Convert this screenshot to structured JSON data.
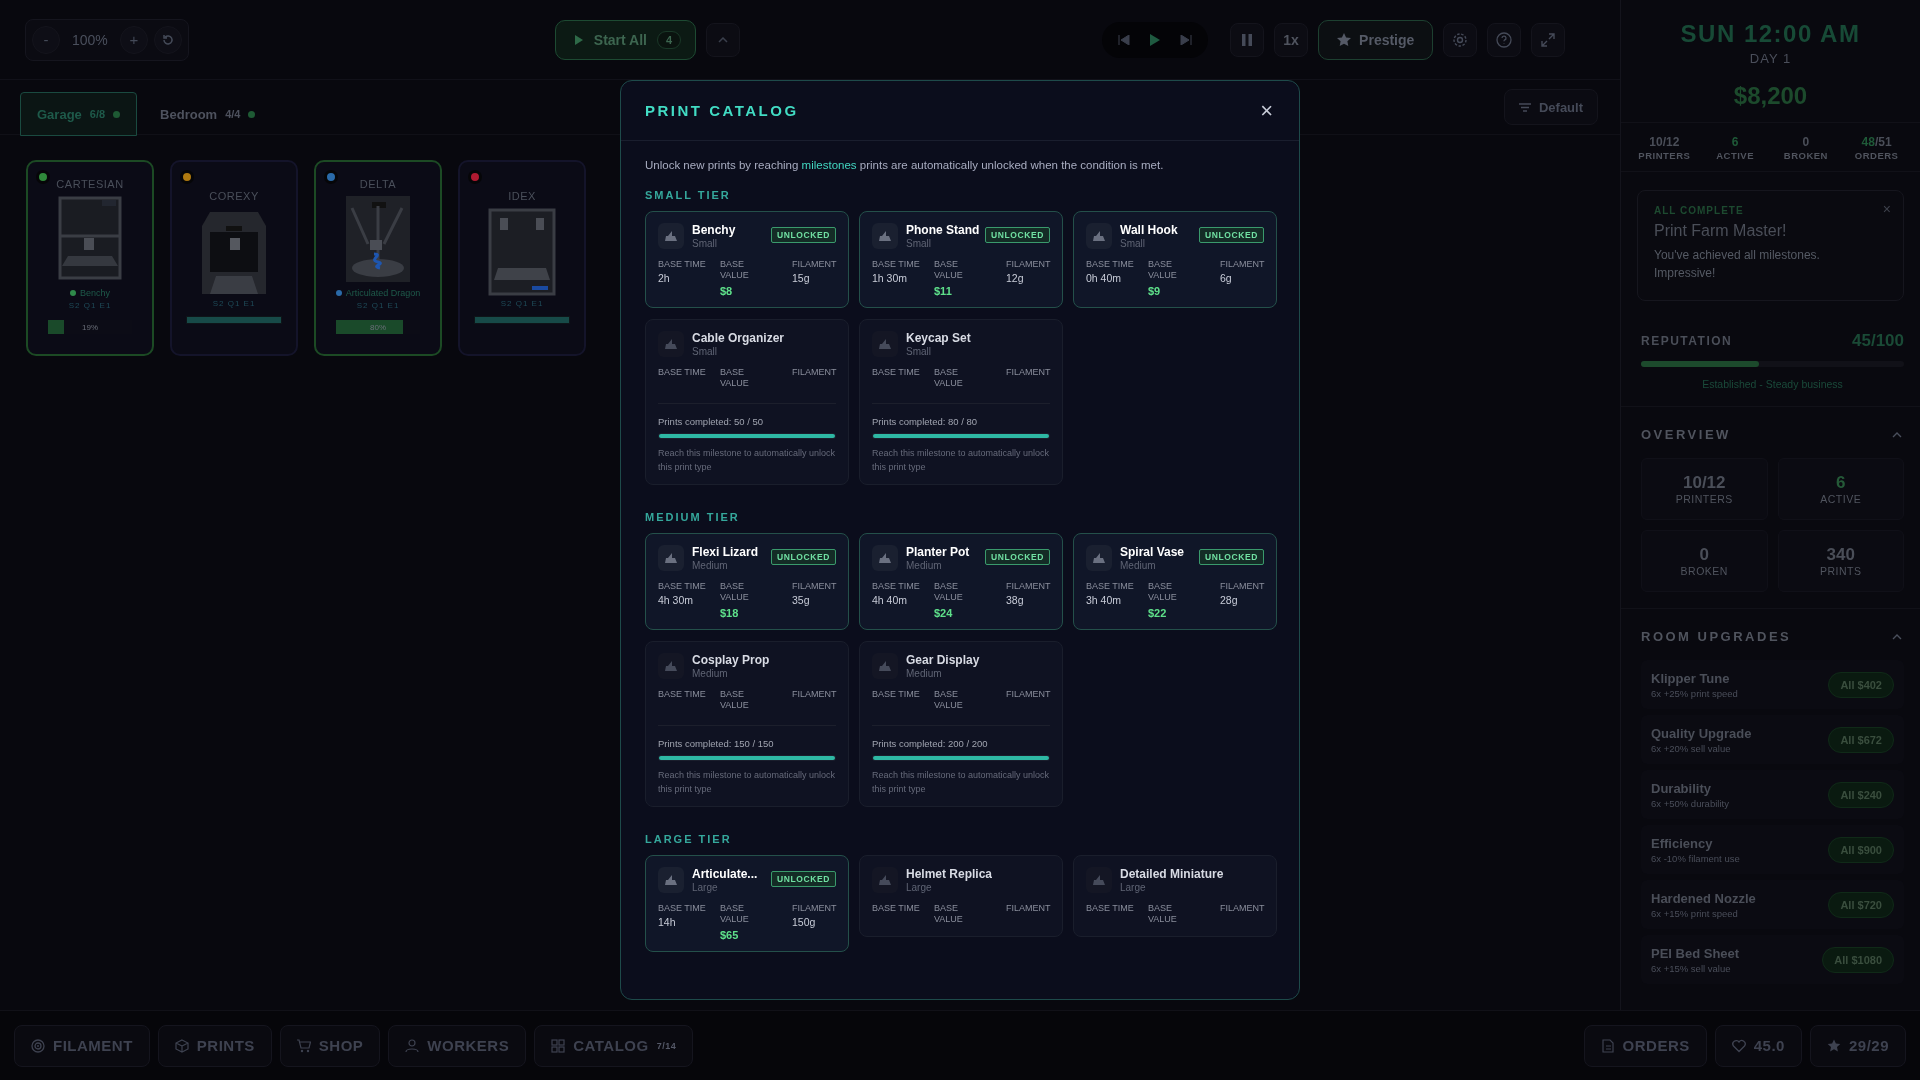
{
  "toolbar": {
    "zoom_out": "-",
    "zoom": "100%",
    "zoom_in": "+",
    "start_all": "Start All",
    "start_count": "4",
    "speed": "1x",
    "prestige": "Prestige"
  },
  "rooms": [
    {
      "name": "Garage",
      "count": "6/8",
      "selected": true
    },
    {
      "name": "Bedroom",
      "count": "4/4",
      "selected": false
    }
  ],
  "sort": "Default",
  "printers": [
    {
      "model": "CARTESIAN",
      "kind": "cartesian",
      "color": "#2f8a3a",
      "printing": true,
      "job": {
        "name": "Benchy",
        "color": "#2f8a4a"
      },
      "stats": "S2 Q1 E1",
      "level": 0.19,
      "reading": "19%"
    },
    {
      "model": "COREXY",
      "kind": "corexy",
      "color": "#b07a10",
      "printing": false,
      "stats": "S2 Q1 E1",
      "level": 1
    },
    {
      "model": "DELTA",
      "kind": "delta",
      "color": "#2a6aa8",
      "printing": true,
      "job": {
        "name": "Articulated Dragon",
        "color": "#2a6aa8"
      },
      "stats": "S2 Q1 E1",
      "level": 0.8,
      "reading": "80%"
    },
    {
      "model": "IDEX",
      "kind": "idex",
      "color": "#b01a30",
      "printing": false,
      "stats": "S2 Q1 E1",
      "level": 1
    }
  ],
  "catalog": {
    "title": "PRINT CATALOG",
    "close": "×",
    "intro": {
      "before": "Unlock new prints by reaching ",
      "link": "milestones",
      "after": " prints are automatically unlocked when the condition is met."
    },
    "tiers": [
      {
        "title": "SMALL TIER",
        "items": [
          {
            "name": "Benchy",
            "size": "Small",
            "unlocked": true,
            "badge": "UNLOCKED",
            "stats": [
              {
                "kind": "time",
                "label": "BASE TIME",
                "value": "2h"
              },
              {
                "kind": "money",
                "label": "BASE VALUE",
                "value": "$8"
              },
              {
                "kind": "weight",
                "label": "FILAMENT",
                "value": "15g"
              }
            ]
          },
          {
            "name": "Phone Stand",
            "size": "Small",
            "unlocked": true,
            "badge": "UNLOCKED",
            "stats": [
              {
                "kind": "time",
                "label": "BASE TIME",
                "value": "1h 30m"
              },
              {
                "kind": "money",
                "label": "BASE VALUE",
                "value": "$11"
              },
              {
                "kind": "weight",
                "label": "FILAMENT",
                "value": "12g"
              }
            ]
          },
          {
            "name": "Wall Hook",
            "size": "Small",
            "unlocked": true,
            "badge": "UNLOCKED",
            "stats": [
              {
                "kind": "time",
                "label": "BASE TIME",
                "value": "0h 40m"
              },
              {
                "kind": "money",
                "label": "BASE VALUE",
                "value": "$9"
              },
              {
                "kind": "weight",
                "label": "FILAMENT",
                "value": "6g"
              }
            ]
          },
          {
            "name": "Cable Organizer",
            "size": "Small",
            "unlocked": false,
            "stats": [
              {
                "kind": "time",
                "label": "BASE TIME"
              },
              {
                "kind": "money",
                "label": "BASE VALUE"
              },
              {
                "kind": "weight",
                "label": "FILAMENT"
              }
            ],
            "progress": {
              "text": "Prints completed: 50 / 50",
              "level": 1,
              "hint": "Reach this milestone to automatically unlock this print type"
            }
          },
          {
            "name": "Keycap Set",
            "size": "Small",
            "unlocked": false,
            "stats": [
              {
                "kind": "time",
                "label": "BASE TIME"
              },
              {
                "kind": "money",
                "label": "BASE VALUE"
              },
              {
                "kind": "weight",
                "label": "FILAMENT"
              }
            ],
            "progress": {
              "text": "Prints completed: 80 / 80",
              "level": 1,
              "hint": "Reach this milestone to automatically unlock this print type"
            }
          }
        ]
      },
      {
        "title": "MEDIUM TIER",
        "items": [
          {
            "name": "Flexi Lizard",
            "size": "Medium",
            "unlocked": true,
            "badge": "UNLOCKED",
            "stats": [
              {
                "kind": "time",
                "label": "BASE TIME",
                "value": "4h 30m"
              },
              {
                "kind": "money",
                "label": "BASE VALUE",
                "value": "$18"
              },
              {
                "kind": "weight",
                "label": "FILAMENT",
                "value": "35g"
              }
            ]
          },
          {
            "name": "Planter Pot",
            "size": "Medium",
            "unlocked": true,
            "badge": "UNLOCKED",
            "stats": [
              {
                "kind": "time",
                "label": "BASE TIME",
                "value": "4h 40m"
              },
              {
                "kind": "money",
                "label": "BASE VALUE",
                "value": "$24"
              },
              {
                "kind": "weight",
                "label": "FILAMENT",
                "value": "38g"
              }
            ]
          },
          {
            "name": "Spiral Vase",
            "size": "Medium",
            "unlocked": true,
            "badge": "UNLOCKED",
            "stats": [
              {
                "kind": "time",
                "label": "BASE TIME",
                "value": "3h 40m"
              },
              {
                "kind": "money",
                "label": "BASE VALUE",
                "value": "$22"
              },
              {
                "kind": "weight",
                "label": "FILAMENT",
                "value": "28g"
              }
            ]
          },
          {
            "name": "Cosplay Prop",
            "size": "Medium",
            "unlocked": false,
            "stats": [
              {
                "kind": "time",
                "label": "BASE TIME"
              },
              {
                "kind": "money",
                "label": "BASE VALUE"
              },
              {
                "kind": "weight",
                "label": "FILAMENT"
              }
            ],
            "progress": {
              "text": "Prints completed: 150 / 150",
              "level": 1,
              "hint": "Reach this milestone to automatically unlock this print type"
            }
          },
          {
            "name": "Gear Display",
            "size": "Medium",
            "unlocked": false,
            "stats": [
              {
                "kind": "time",
                "label": "BASE TIME"
              },
              {
                "kind": "money",
                "label": "BASE VALUE"
              },
              {
                "kind": "weight",
                "label": "FILAMENT"
              }
            ],
            "progress": {
              "text": "Prints completed: 200 / 200",
              "level": 1,
              "hint": "Reach this milestone to automatically unlock this print type"
            }
          }
        ]
      },
      {
        "title": "LARGE TIER",
        "items": [
          {
            "name": "Articulate...",
            "size": "Large",
            "unlocked": true,
            "badge": "UNLOCKED",
            "stats": [
              {
                "kind": "time",
                "label": "BASE TIME",
                "value": "14h"
              },
              {
                "kind": "money",
                "label": "BASE VALUE",
                "value": "$65"
              },
              {
                "kind": "weight",
                "label": "FILAMENT",
                "value": "150g"
              }
            ]
          },
          {
            "name": "Helmet Replica",
            "size": "Large",
            "unlocked": false,
            "stats": [
              {
                "kind": "time",
                "label": "BASE TIME"
              },
              {
                "kind": "money",
                "label": "BASE VALUE"
              },
              {
                "kind": "weight",
                "label": "FILAMENT"
              }
            ]
          },
          {
            "name": "Detailed Miniature",
            "size": "Large",
            "unlocked": false,
            "stats": [
              {
                "kind": "time",
                "label": "BASE TIME"
              },
              {
                "kind": "money",
                "label": "BASE VALUE"
              },
              {
                "kind": "weight",
                "label": "FILAMENT"
              }
            ]
          }
        ]
      }
    ]
  },
  "sidebar": {
    "clock": "SUN 12:00 AM",
    "day": "DAY 1",
    "money": "$8,200",
    "stats": [
      {
        "value": "10/12",
        "label": "PRINTERS"
      },
      {
        "value": "6",
        "label": "ACTIVE"
      },
      {
        "value": "0",
        "label": "BROKEN"
      },
      {
        "value": "48",
        "total": "/51",
        "label": "ORDERS"
      }
    ],
    "notice": {
      "tag": "ALL COMPLETE",
      "title": "Print Farm Master!",
      "text": "You've achieved all milestones. Impressive!",
      "close": "×"
    },
    "reputation": {
      "label": "REPUTATION",
      "value": "45/100",
      "level": 0.45,
      "status": "Established - Steady business"
    },
    "overview": {
      "title": "OVERVIEW",
      "tiles": [
        {
          "value": "10/12",
          "label": "PRINTERS"
        },
        {
          "value": "6",
          "label": "ACTIVE",
          "highlight": true
        },
        {
          "value": "0",
          "label": "BROKEN"
        },
        {
          "value": "340",
          "label": "PRINTS"
        }
      ]
    },
    "upgrades": {
      "title": "ROOM UPGRADES",
      "items": [
        {
          "name": "Klipper Tune",
          "desc": "6x +25% print speed",
          "button": "All $402"
        },
        {
          "name": "Quality Upgrade",
          "desc": "6x +20% sell value",
          "button": "All $672"
        },
        {
          "name": "Durability",
          "desc": "6x +50% durability",
          "button": "All $240"
        },
        {
          "name": "Efficiency",
          "desc": "6x -10% filament use",
          "button": "All $900"
        },
        {
          "name": "Hardened Nozzle",
          "desc": "6x +15% print speed",
          "button": "All $720"
        },
        {
          "name": "PEI Bed Sheet",
          "desc": "6x +15% sell value",
          "button": "All $1080"
        }
      ]
    }
  },
  "bottom_nav": [
    {
      "kind": "filament",
      "label": "FILAMENT"
    },
    {
      "kind": "prints",
      "label": "PRINTS"
    },
    {
      "kind": "shop",
      "label": "SHOP"
    },
    {
      "kind": "workers",
      "label": "WORKERS"
    },
    {
      "kind": "catalog",
      "label": "CATALOG",
      "count": "7/14"
    }
  ],
  "bottom_right": [
    {
      "kind": "orders",
      "label": "ORDERS"
    },
    {
      "kind": "health",
      "label": "45.0"
    },
    {
      "kind": "stars",
      "label": "29/29"
    }
  ]
}
